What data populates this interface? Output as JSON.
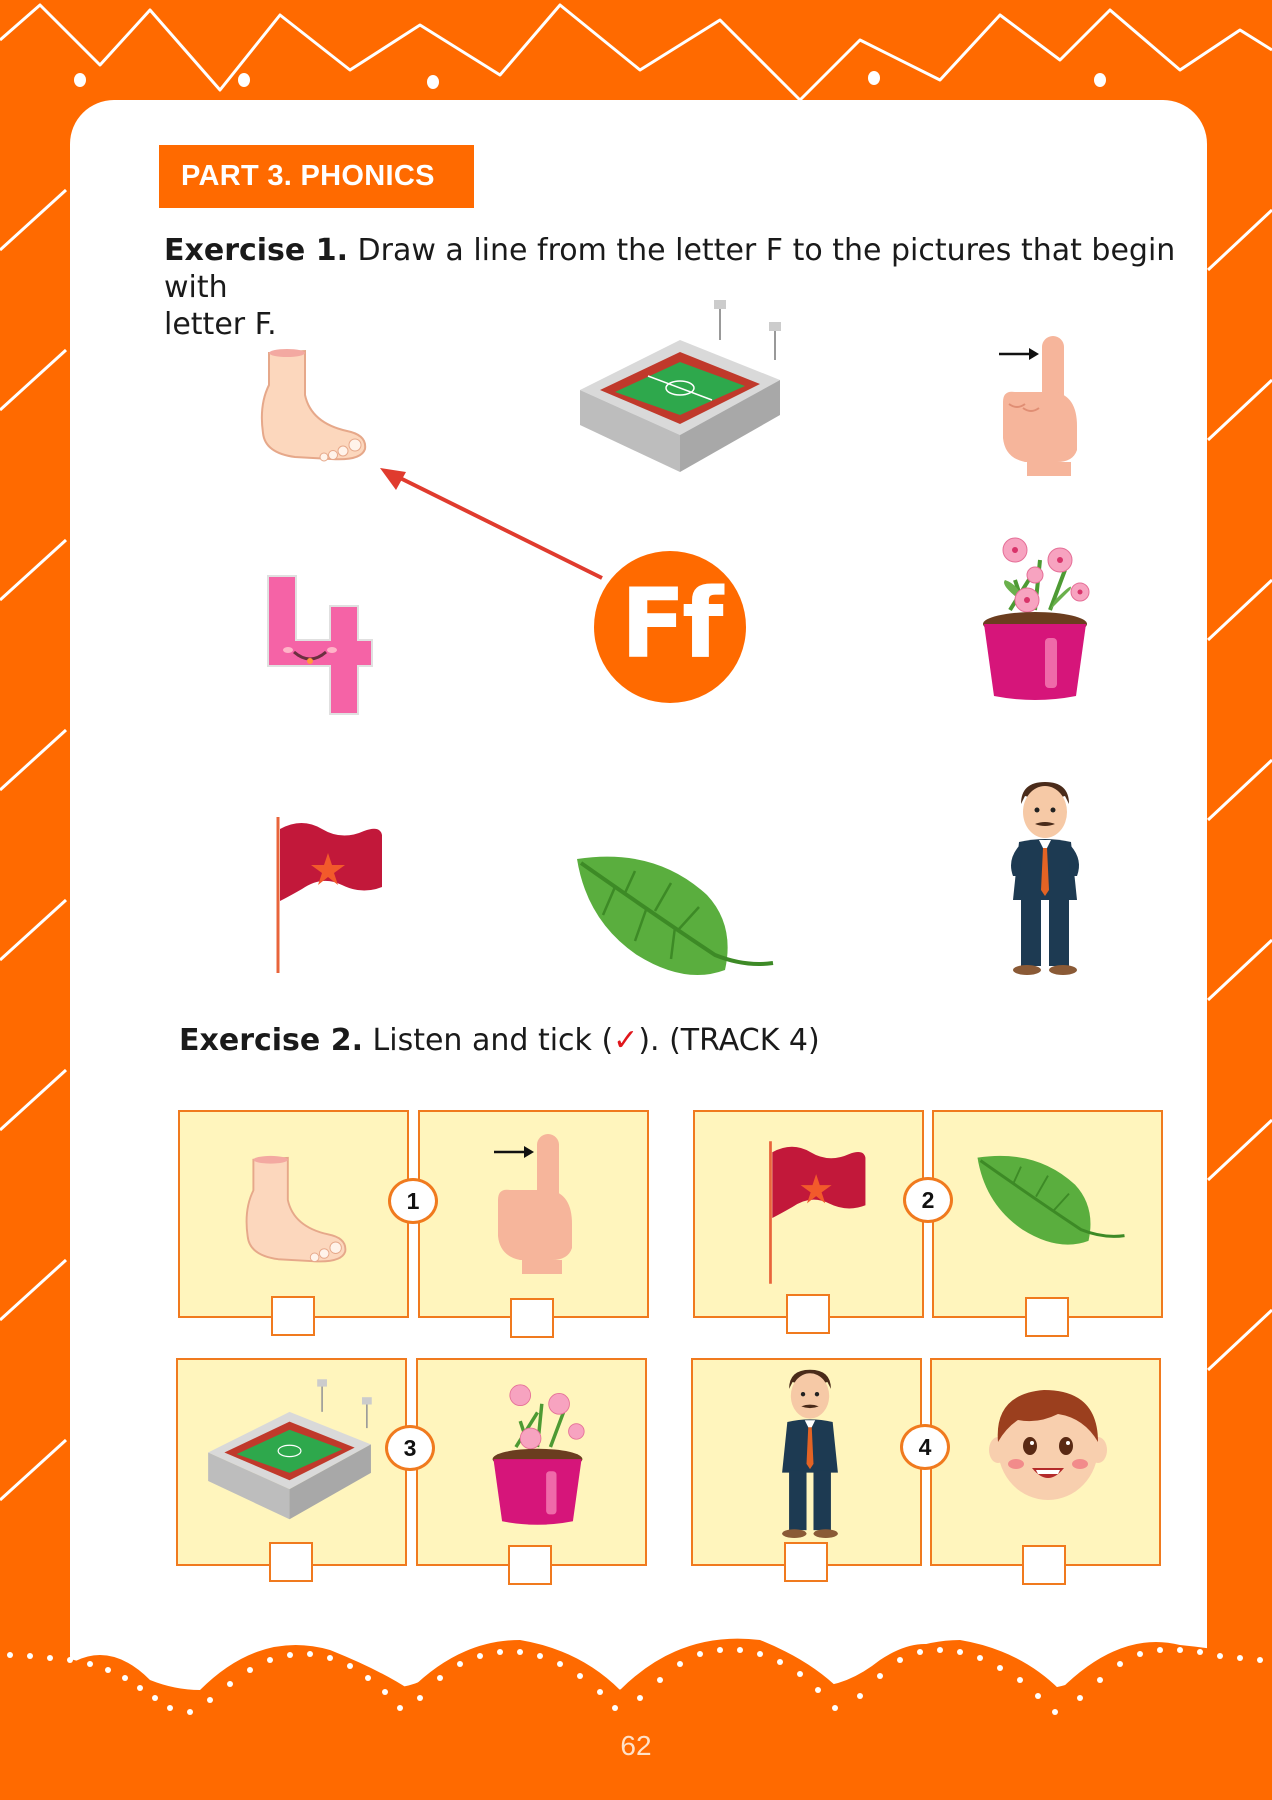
{
  "part_title": "PART 3. PHONICS",
  "exercise1": {
    "label": "Exercise 1.",
    "instruction_line1": "Draw a line from the letter F to the pictures that begin with",
    "instruction_line2": "letter F.",
    "center_letter": "Ff",
    "pictures": [
      "foot",
      "stadium",
      "finger",
      "four",
      "flower-pot",
      "flag",
      "leaf",
      "father"
    ],
    "connected_example": "foot"
  },
  "exercise2": {
    "label": "Exercise 2.",
    "instruction_before": "Listen and tick (",
    "tick_symbol": "✓",
    "instruction_after": "). (TRACK 4)",
    "items": [
      {
        "number": "1",
        "left": "foot",
        "right": "finger"
      },
      {
        "number": "2",
        "left": "flag",
        "right": "leaf"
      },
      {
        "number": "3",
        "left": "stadium",
        "right": "flower-pot"
      },
      {
        "number": "4",
        "left": "father",
        "right": "boy-face"
      }
    ]
  },
  "page_number": "62",
  "colors": {
    "brand_orange": "#ff6a00",
    "panel_fill": "#fff5bd",
    "panel_border": "#f07a1e",
    "arrow_red": "#e03b2e",
    "tick_red": "#e0161b"
  }
}
